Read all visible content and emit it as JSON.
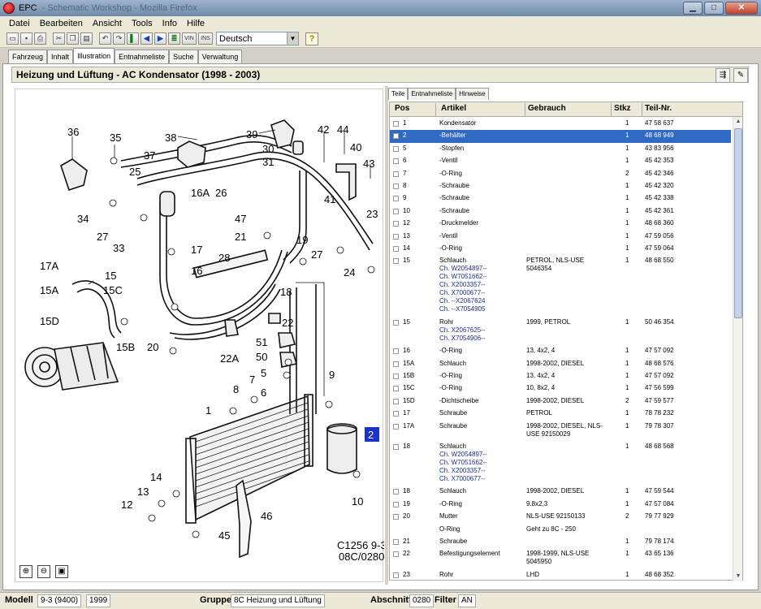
{
  "window": {
    "title": "EPC",
    "title_dim": "- Schematic Workshop - Mozilla Firefox"
  },
  "menu": [
    "Datei",
    "Bearbeiten",
    "Ansicht",
    "Tools",
    "Info",
    "Hilfe"
  ],
  "toolbar": {
    "language": "Deutsch",
    "vin_label": "VIN",
    "ins_label": "INS",
    "help_label": "?"
  },
  "main_tabs": [
    "Fahrzeug",
    "Inhalt",
    "Illustration",
    "Entnahmeliste",
    "Suche",
    "Verwaltung"
  ],
  "active_main_tab": "Illustration",
  "header": {
    "title": "Heizung und Lüftung - AC Kondensator   (1998 - 2003)"
  },
  "sub_tabs": [
    "Teile",
    "Entnahmeliste",
    "Hinweise"
  ],
  "table": {
    "columns": [
      "Pos",
      "Artikel",
      "Gebrauch",
      "Stkz",
      "Teil-Nr."
    ],
    "rows": [
      {
        "pos": "1",
        "artikel": "Kondensator",
        "gebrauch": "",
        "stkz": "1",
        "teil": "47 58 637"
      },
      {
        "pos": "2",
        "artikel": "-Behälter",
        "gebrauch": "",
        "stkz": "1",
        "teil": "48 68 949",
        "selected": true
      },
      {
        "pos": "5",
        "artikel": "-Stopfen",
        "gebrauch": "",
        "stkz": "1",
        "teil": "43 83 956"
      },
      {
        "pos": "6",
        "artikel": "-Ventil",
        "gebrauch": "",
        "stkz": "1",
        "teil": "45 42 353"
      },
      {
        "pos": "7",
        "artikel": "-O-Ring",
        "gebrauch": "",
        "stkz": "2",
        "teil": "45 42 346"
      },
      {
        "pos": "8",
        "artikel": "-Schraube",
        "gebrauch": "",
        "stkz": "1",
        "teil": "45 42 320"
      },
      {
        "pos": "9",
        "artikel": "-Schraube",
        "gebrauch": "",
        "stkz": "1",
        "teil": "45 42 338"
      },
      {
        "pos": "10",
        "artikel": "-Schraube",
        "gebrauch": "",
        "stkz": "1",
        "teil": "45 42 361"
      },
      {
        "pos": "12",
        "artikel": "-Druckmelder",
        "gebrauch": "",
        "stkz": "1",
        "teil": "48 68 360"
      },
      {
        "pos": "13",
        "artikel": "-Ventil",
        "gebrauch": "",
        "stkz": "1",
        "teil": "47 59 056"
      },
      {
        "pos": "14",
        "artikel": "-O-Ring",
        "gebrauch": "",
        "stkz": "1",
        "teil": "47 59 064"
      },
      {
        "pos": "15",
        "artikel": "Schlauch",
        "gebrauch": "PETROL, NLS-USE 5046354",
        "stkz": "1",
        "teil": "48 68 550",
        "notes": [
          "Ch. W2054897--",
          "Ch. W7051662--",
          "Ch. X2003357--",
          "Ch. X7000677--",
          "Ch. --X2067624",
          "Ch. --X7054905"
        ]
      },
      {
        "pos": "15",
        "artikel": "Rohr",
        "gebrauch": "1999, PETROL",
        "stkz": "1",
        "teil": "50 46 354",
        "notes": [
          "Ch. X2067625--",
          "Ch. X7054906--"
        ]
      },
      {
        "pos": "16",
        "artikel": "-O-Ring",
        "gebrauch": "13, 4x2, 4",
        "stkz": "1",
        "teil": "47 57 092"
      },
      {
        "pos": "15A",
        "artikel": "Schlauch",
        "gebrauch": "1998-2002, DIESEL",
        "stkz": "1",
        "teil": "48 68 576"
      },
      {
        "pos": "15B",
        "artikel": "-O-Ring",
        "gebrauch": "13, 4x2, 4",
        "stkz": "1",
        "teil": "47 57 092"
      },
      {
        "pos": "15C",
        "artikel": "-O-Ring",
        "gebrauch": "10, 8x2, 4",
        "stkz": "1",
        "teil": "47 56 599"
      },
      {
        "pos": "15D",
        "artikel": "-Dichtscheibe",
        "gebrauch": "1998-2002, DIESEL",
        "stkz": "2",
        "teil": "47 59 577"
      },
      {
        "pos": "17",
        "artikel": "Schraube",
        "gebrauch": "PETROL",
        "stkz": "1",
        "teil": "78 78 232"
      },
      {
        "pos": "17A",
        "artikel": "Schraube",
        "gebrauch": "1998-2002, DIESEL, NLS-USE 92150029",
        "stkz": "1",
        "teil": "79 78 307"
      },
      {
        "pos": "18",
        "artikel": "Schlauch",
        "gebrauch": "",
        "stkz": "1",
        "teil": "48 68 568",
        "notes": [
          "Ch. W2054897--",
          "Ch. W7051662--",
          "Ch. X2003357--",
          "Ch. X7000677--"
        ]
      },
      {
        "pos": "18",
        "artikel": "Schlauch",
        "gebrauch": "1998-2002, DIESEL",
        "stkz": "1",
        "teil": "47 59 544"
      },
      {
        "pos": "19",
        "artikel": "-O-Ring",
        "gebrauch": "9.8x2,3",
        "stkz": "1",
        "teil": "47 57 084"
      },
      {
        "pos": "20",
        "artikel": "Mutter",
        "gebrauch": "NLS-USE 92150133",
        "stkz": "2",
        "teil": "79 77 929"
      },
      {
        "pos": "",
        "artikel": "O-Ring",
        "gebrauch": "Geht zu 8C - 250",
        "stkz": "",
        "teil": "",
        "nocheck": true
      },
      {
        "pos": "21",
        "artikel": "Schraube",
        "gebrauch": "",
        "stkz": "1",
        "teil": "79 78 174"
      },
      {
        "pos": "22",
        "artikel": "Befestigungselement",
        "gebrauch": "1998-1999, NLS-USE 5045950",
        "stkz": "1",
        "teil": "43 65 136"
      },
      {
        "pos": "23",
        "artikel": "Rohr",
        "gebrauch": "LHD",
        "stkz": "1",
        "teil": "48 68 352"
      }
    ]
  },
  "illustration": {
    "code_line1": "C1256 9-3",
    "code_line2": "08C/0280",
    "callouts": [
      "36",
      "35",
      "38",
      "39",
      "30",
      "31",
      "42",
      "44",
      "40",
      "43",
      "37",
      "25",
      "16A",
      "26",
      "34",
      "27",
      "47",
      "41",
      "21",
      "23",
      "33",
      "17",
      "19",
      "28",
      "27",
      "24",
      "17A",
      "15",
      "16",
      "15A",
      "15C",
      "18",
      "15D",
      "22",
      "15B",
      "20",
      "51",
      "50",
      "22A",
      "5",
      "7",
      "9",
      "8",
      "6",
      "1",
      "2",
      "14",
      "13",
      "10",
      "12",
      "46",
      "45"
    ],
    "selected_callout": "2"
  },
  "status": {
    "modell_label": "Modell",
    "modell": "9-3 (9400)",
    "jahr": "1999",
    "gruppe_label": "Gruppe",
    "gruppe": "8C Heizung und Lüftung",
    "abschnitt_label": "Abschnitt",
    "abschnitt": "0280",
    "filter_label": "Filter",
    "filter": "AN"
  }
}
